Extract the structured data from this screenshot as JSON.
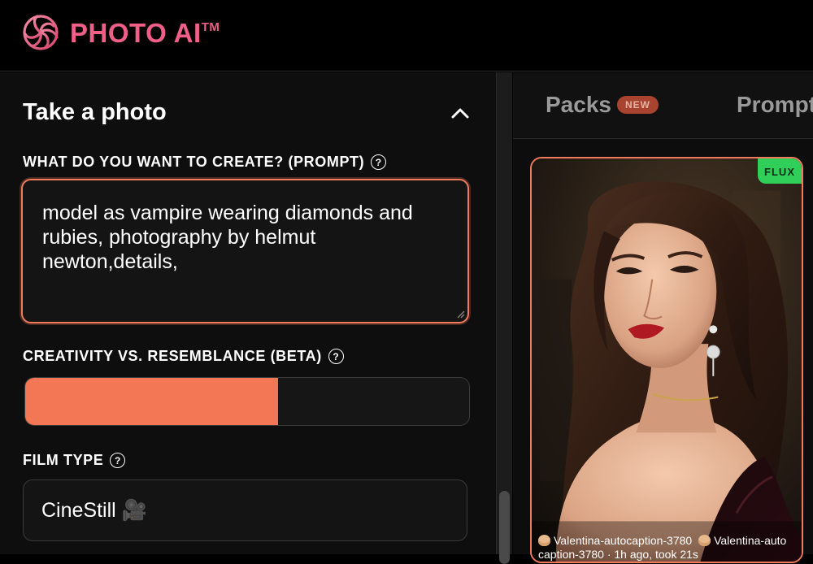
{
  "app": {
    "name": "PHOTO AI",
    "trademark": "TM",
    "brand_color": "#ef5f87",
    "accent_color": "#f07a5b"
  },
  "left_panel": {
    "section_title": "Take a photo",
    "prompt": {
      "label": "WHAT DO YOU WANT TO CREATE? (PROMPT)",
      "value": "model as vampire wearing diamonds and rubies, photography by helmut newton,details,"
    },
    "creativity": {
      "label": "CREATIVITY VS. RESEMBLANCE (BETA)",
      "level_fraction": 0.57
    },
    "film_type": {
      "label": "FILM TYPE",
      "value": "CineStill 🎥"
    }
  },
  "right_panel": {
    "tabs": [
      {
        "label": "Packs",
        "badge": "NEW"
      },
      {
        "label": "Prompt"
      }
    ],
    "card": {
      "model_badge": "FLUX",
      "caption_line1": "Valentina-autocaption-3780",
      "caption_line1b": "Valentina-auto",
      "caption_line2": "caption-3780 · 1h ago, took 21s"
    }
  },
  "icons": {
    "logo": "photo-ai-spiral-logo",
    "help": "question-circle-icon",
    "collapse": "chevron-up-icon",
    "avatar": "person-emoji-icon"
  }
}
